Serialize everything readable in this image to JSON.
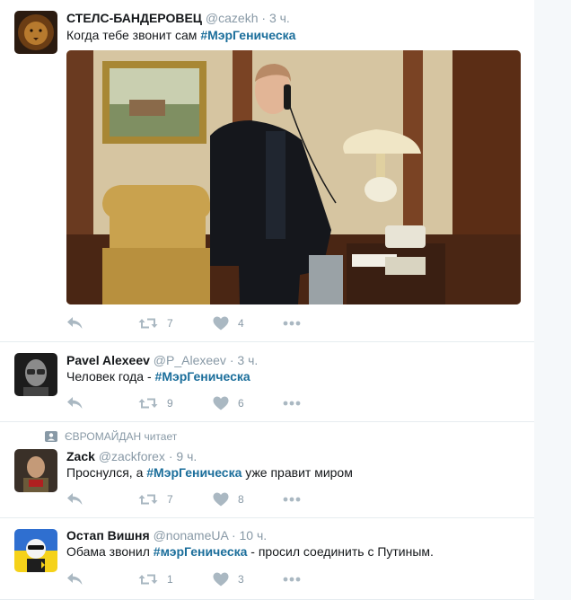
{
  "tweets": [
    {
      "name": "СТЕЛС-БАНДЕРОВЕЦ",
      "handle": "@cazekh",
      "time": "3 ч.",
      "text": "Когда тебе звонит сам ",
      "hashtag": "#МэрГеническа",
      "text_after": "",
      "retweets": "7",
      "likes": "4"
    },
    {
      "name": "Pavel Alexeev",
      "handle": "@P_Alexeev",
      "time": "3 ч.",
      "text": "Человек года - ",
      "hashtag": "#МэрГеническа",
      "text_after": "",
      "retweets": "9",
      "likes": "6"
    },
    {
      "context": "ЄВРОМАЙДАН читает",
      "name": "Zack",
      "handle": "@zackforex",
      "time": "9 ч.",
      "text": "Проснулся, а ",
      "hashtag": "#МэрГеническа",
      "text_after": " уже правит миром",
      "retweets": "7",
      "likes": "8"
    },
    {
      "name": "Остап Вишня",
      "handle": "@nonameUA",
      "time": "10 ч.",
      "text": "Обама звонил ",
      "hashtag": "#мэрГеническа",
      "text_after": " - просил соединить с Путиным.",
      "retweets": "1",
      "likes": "3"
    }
  ],
  "separator": "·",
  "colors": {
    "hashtag": "#1b6e9b",
    "muted": "#8899a6",
    "icon": "#aab8c2"
  }
}
